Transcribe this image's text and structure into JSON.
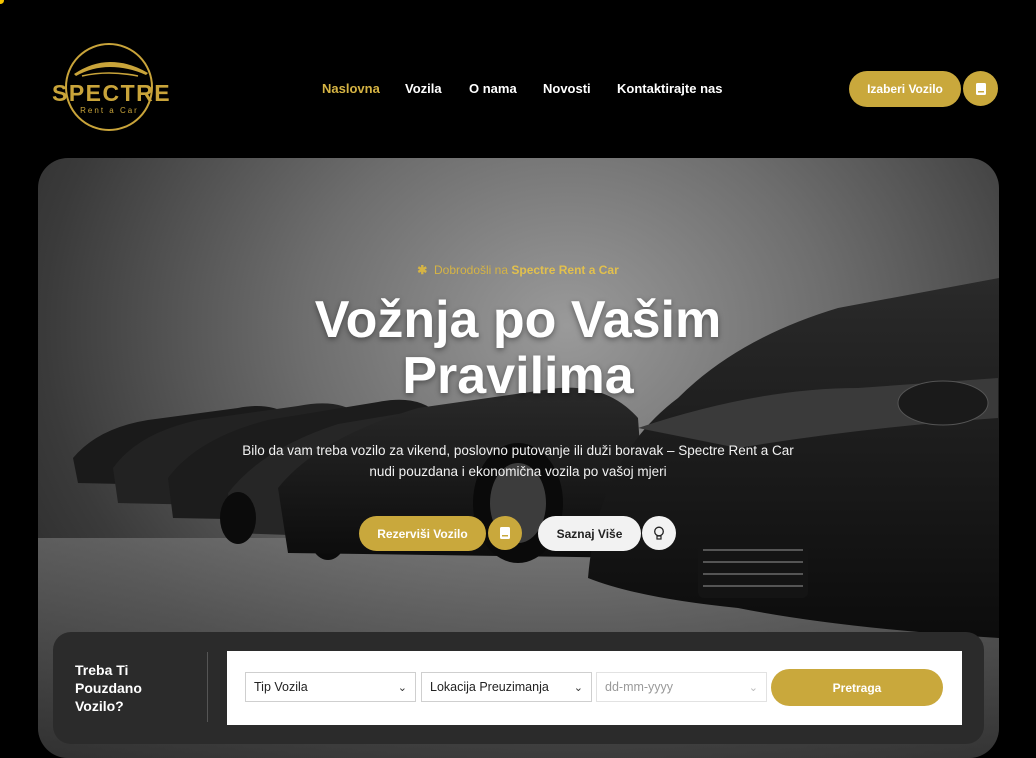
{
  "brand": {
    "name": "SPECTRE",
    "tagline": "Rent a Car",
    "accent": "#c9a83c"
  },
  "nav": {
    "items": [
      {
        "label": "Naslovna",
        "active": true
      },
      {
        "label": "Vozila",
        "active": false
      },
      {
        "label": "O nama",
        "active": false
      },
      {
        "label": "Novosti",
        "active": false
      },
      {
        "label": "Kontaktirajte nas",
        "active": false
      }
    ],
    "cta_label": "Izaberi Vozilo",
    "cta_icon": "book-icon"
  },
  "hero": {
    "welcome_prefix": "Dobrodošli na",
    "welcome_brand": "Spectre Rent a Car",
    "welcome_icon": "asterisk-icon",
    "title_line1": "Vožnja po Vašim",
    "title_line2": "Pravilima",
    "description_line1": "Bilo da vam treba vozilo za vikend, poslovno putovanje ili duži boravak – Spectre Rent a Car",
    "description_line2": "nudi pouzdana i ekonomična vozila po vašoj mjeri",
    "primary_button": "Rezerviši Vozilo",
    "primary_icon": "book-icon",
    "secondary_button": "Saznaj Više",
    "secondary_icon": "lightbulb-icon"
  },
  "search": {
    "title": "Treba Ti Pouzdano Vozilo?",
    "vehicle_type": "Tip Vozila",
    "pickup_location": "Lokacija Preuzimanja",
    "date_placeholder": "dd-mm-yyyy",
    "submit_label": "Pretraga"
  }
}
